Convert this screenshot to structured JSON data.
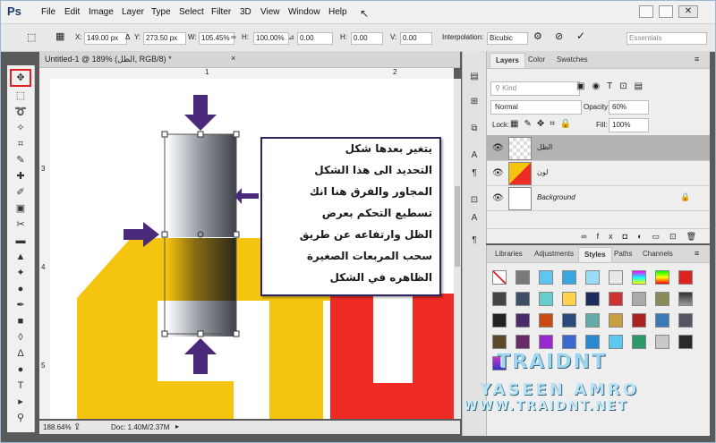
{
  "app": {
    "logo": "Ps"
  },
  "menu": [
    "File",
    "Edit",
    "Image",
    "Layer",
    "Type",
    "Select",
    "Filter",
    "3D",
    "View",
    "Window",
    "Help"
  ],
  "options": {
    "x_label": "X:",
    "x_value": "149.00 px",
    "y_label": "Y:",
    "y_value": "273.50 px",
    "w_label": "W:",
    "w_value": "105.45%",
    "h_label": "H:",
    "h_value": "100.00%",
    "angle_value": "0.00",
    "hskew_label": "H:",
    "hskew_value": "0.00",
    "vskew_label": "V:",
    "vskew_value": "0.00",
    "interp_label": "Interpolation:",
    "interp_value": "Bicubic",
    "workspace": "Essentials"
  },
  "document": {
    "tab_title": "Untitled-1 @ 189% (الظل, RGB/8) *",
    "zoom": "188.64%",
    "doc_info": "Doc: 1.40M/2.37M"
  },
  "rulers": {
    "h_ticks": [
      "1",
      "2"
    ],
    "v_ticks": [
      "3",
      "4",
      "5"
    ]
  },
  "layers_panel": {
    "tabs": [
      "Layers",
      "Color",
      "Swatches"
    ],
    "filter_kind": "Kind",
    "blend_mode": "Normal",
    "opacity_label": "Opacity:",
    "opacity_value": "60%",
    "lock_label": "Lock:",
    "fill_label": "Fill:",
    "fill_value": "100%",
    "layers": [
      {
        "name": "الظل",
        "selected": true
      },
      {
        "name": "لون",
        "selected": false
      },
      {
        "name": "Background",
        "selected": false
      }
    ]
  },
  "styles_panel": {
    "tabs": [
      "Libraries",
      "Adjustments",
      "Styles",
      "Paths",
      "Channels"
    ]
  },
  "callout": {
    "lines": [
      "يتغير بعدها شكل",
      "التحديد الى هذا الشكل",
      "المجاور والفرق هنا انك",
      "تسطيع التحكم بعرض",
      "الظل وارتفاعه عن طريق",
      "سحب المربعات الصغيرة",
      "الظاهره في الشكل"
    ]
  },
  "watermark": {
    "line1": "TRAIDNT",
    "line2": "YASEEN AMRO",
    "line3": "WWW.TRAIDNT.NET"
  },
  "colors": {
    "accent_yellow": "#f5c40e",
    "accent_red": "#ee2b25",
    "arrow": "#4b2a7b",
    "callout_border": "#2b2660",
    "highlight": "#e41e25"
  }
}
